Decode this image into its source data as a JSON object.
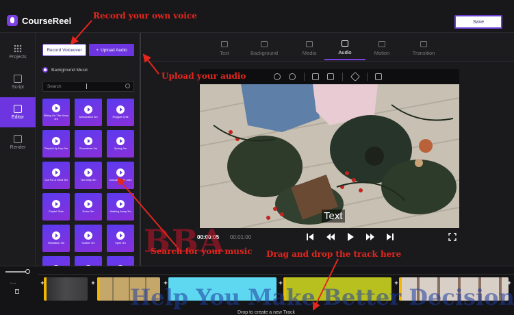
{
  "app": {
    "name": "CourseReel"
  },
  "header": {
    "save_label": "Save"
  },
  "nav": {
    "items": [
      {
        "label": "Projects"
      },
      {
        "label": "Script"
      },
      {
        "label": "Editor",
        "active": true
      },
      {
        "label": "Render"
      }
    ]
  },
  "panel": {
    "record_label": "Record Voiceover",
    "upload_label": "Upload Audio",
    "section_label": "Background Music",
    "search_placeholder": "Search",
    "tracks": [
      "Sitting On The Moon 3m",
      "Anticipation 3m",
      "Reggae Chill",
      "Playful Hip Hop 3m",
      "Showdown 3m",
      "Spring 3m",
      "Out For A Stroll 3m",
      "Two Way 3m",
      "Casual Beats Jazz",
      "Playful Skits",
      "Relax 3m",
      "Walking Away 3m",
      "Hesitation 3m",
      "Scatter 3m",
      "Spirit 3m",
      "",
      "",
      ""
    ]
  },
  "tabs": [
    {
      "label": "Text"
    },
    {
      "label": "Background"
    },
    {
      "label": "Media"
    },
    {
      "label": "Audio",
      "active": true
    },
    {
      "label": "Motion"
    },
    {
      "label": "Transition"
    }
  ],
  "player": {
    "overlay_text": "Text",
    "current_time": "00:00:05",
    "total_time": "00:01:00"
  },
  "timeline": {
    "track_label": "Track",
    "drop_label": "Drop to create a new Track",
    "clip_colors": [
      "#3a3a3e",
      "#e8c96a",
      "#5ed8f0",
      "#b8c01f",
      "#d8cfc6"
    ]
  },
  "annotations": {
    "record": "Record your own voice",
    "upload": "Upload your audio",
    "search": "Search for your music",
    "drag": "Drag and drop the track here"
  },
  "watermark": {
    "big": "BBA",
    "line": "Help You Make Better Decisions"
  },
  "accent_color": "#6c35e0",
  "annotation_color": "#e5261d"
}
